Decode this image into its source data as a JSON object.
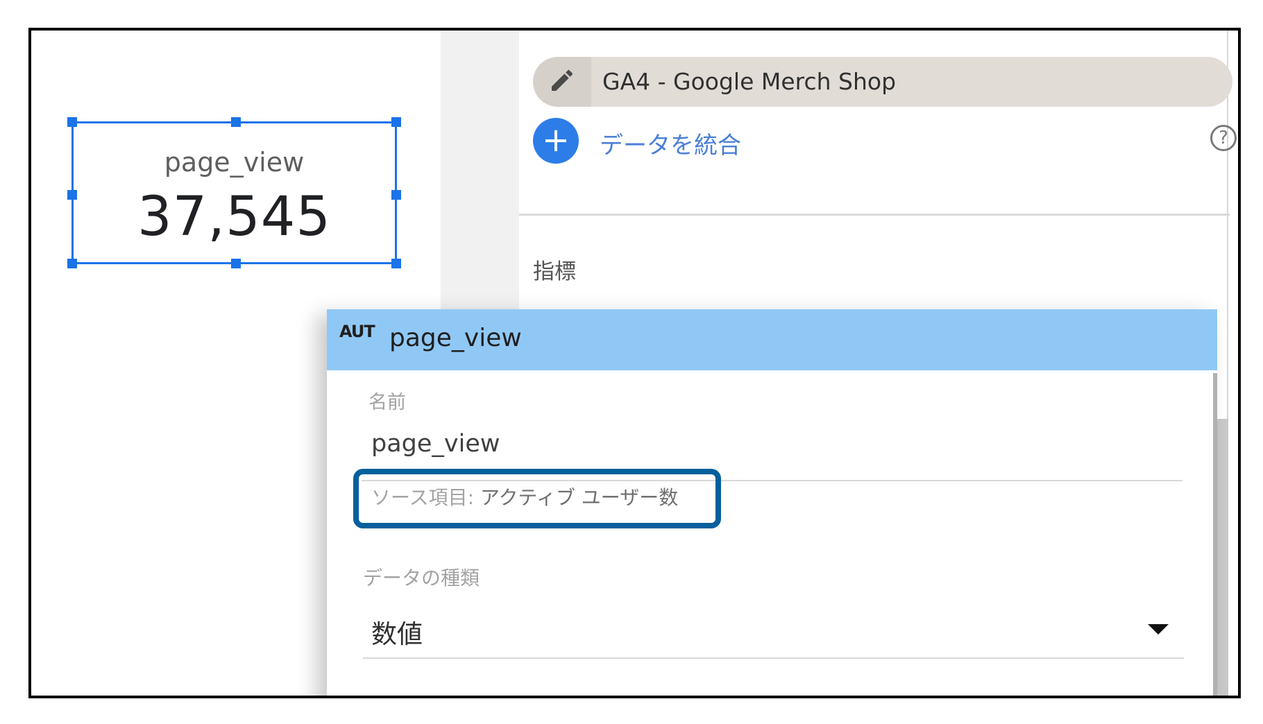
{
  "canvas": {
    "scorecard": {
      "label": "page_view",
      "value": "37,545"
    }
  },
  "panel": {
    "data_source": {
      "name": "GA4 - Google Merch Shop",
      "edit_icon": "pencil-icon"
    },
    "blend": {
      "label": "データを統合",
      "add_icon": "plus-icon",
      "help_icon": "help-circle-icon",
      "help_glyph": "?"
    },
    "metrics_label": "指標"
  },
  "field_popup": {
    "type_badge": "AUT",
    "title": "page_view",
    "name_label": "名前",
    "name_value": "page_view",
    "source_prefix": "ソース項目: ",
    "source_field": "アクティブ ユーザー数",
    "data_type_label": "データの種類",
    "data_type_value": "数値",
    "dropdown_icon": "caret-down-icon"
  },
  "colors": {
    "selection_blue": "#1a73e8",
    "popup_header": "#90c8f5",
    "highlight_border": "#04609d",
    "blend_blue": "#2d7de8"
  }
}
